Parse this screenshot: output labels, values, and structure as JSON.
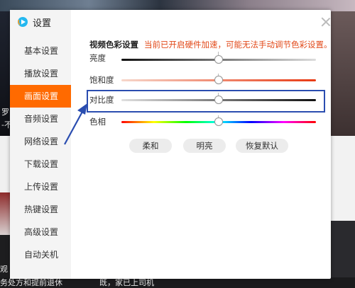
{
  "background": {
    "captions": [
      "罗",
      "-不",
      "观",
      "务处方和提前退休",
      "既，家已上司机"
    ]
  },
  "dialog": {
    "title": "设置",
    "close_icon": "close-icon",
    "nav": [
      {
        "label": "基本设置",
        "active": false
      },
      {
        "label": "播放设置",
        "active": false
      },
      {
        "label": "画面设置",
        "active": true
      },
      {
        "label": "音频设置",
        "active": false
      },
      {
        "label": "网络设置",
        "active": false
      },
      {
        "label": "下载设置",
        "active": false
      },
      {
        "label": "上传设置",
        "active": false
      },
      {
        "label": "热键设置",
        "active": false
      },
      {
        "label": "高级设置",
        "active": false
      },
      {
        "label": "自动关机",
        "active": false
      }
    ],
    "section_title": "视频色彩设置",
    "section_note": "当前已开启硬件加速，可能无法手动调节色彩设置。",
    "sliders": [
      {
        "label": "亮度",
        "value": 0.5
      },
      {
        "label": "饱和度",
        "value": 0.5
      },
      {
        "label": "对比度",
        "value": 0.5
      },
      {
        "label": "色相",
        "value": 0.5
      }
    ],
    "buttons": [
      "柔和",
      "明亮",
      "恢复默认"
    ],
    "accent_color": "#ff6a00",
    "note_color": "#e24a1a",
    "highlight_color": "#2a4db0"
  }
}
